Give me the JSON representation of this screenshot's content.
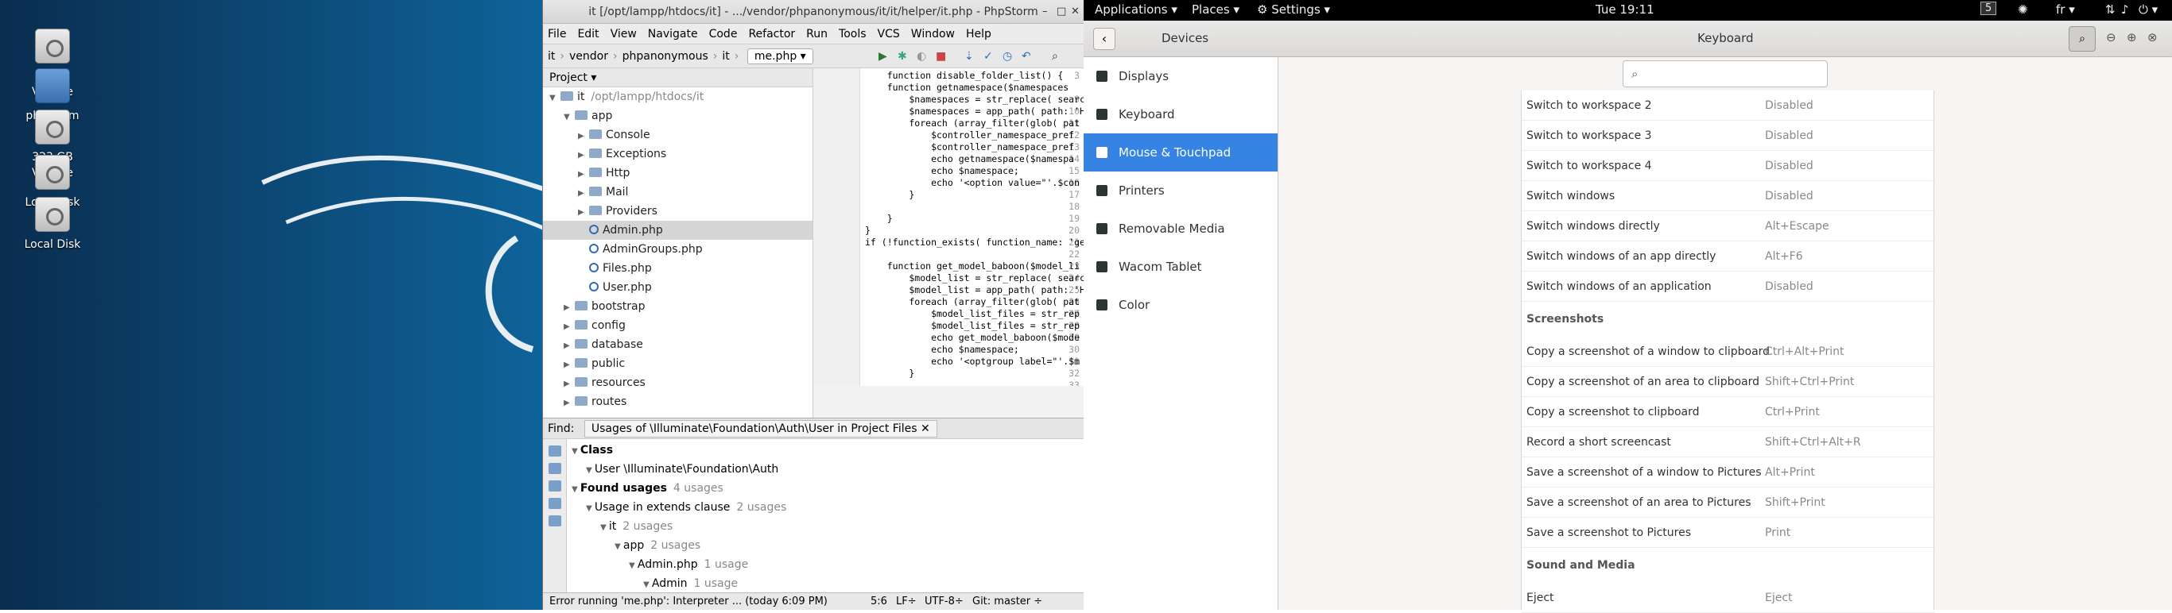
{
  "desktop": {
    "icons": [
      {
        "label": "2GB Volume",
        "type": "drive"
      },
      {
        "label": "phpstorm",
        "type": "folder"
      },
      {
        "label": "323 GB Volume",
        "type": "drive"
      },
      {
        "label": "Local disk",
        "type": "drive"
      },
      {
        "label": "Local Disk",
        "type": "drive"
      }
    ]
  },
  "topbar": {
    "applications": "Applications ▾",
    "places": "Places ▾",
    "settings": "Settings ▾",
    "clock": "Tue 19:11",
    "workspace": "5",
    "lang": "fr ▾"
  },
  "phpstorm": {
    "title": "it [/opt/lampp/htdocs/it] - .../vendor/phpanonymous/it/it/helper/it.php - PhpStorm",
    "menu": [
      "File",
      "Edit",
      "View",
      "Navigate",
      "Code",
      "Refactor",
      "Run",
      "Tools",
      "VCS",
      "Window",
      "Help"
    ],
    "breadcrumbs": [
      "it",
      "vendor",
      "phpanonymous",
      "it"
    ],
    "file_tab": "me.php ▾",
    "project_header": "Project ▾",
    "tree": [
      {
        "label": "it",
        "extra": "/opt/lampp/htdocs/it",
        "kind": "folder",
        "depth": 0,
        "open": true
      },
      {
        "label": "app",
        "kind": "folder",
        "depth": 1,
        "open": true
      },
      {
        "label": "Console",
        "kind": "folder",
        "depth": 2
      },
      {
        "label": "Exceptions",
        "kind": "folder",
        "depth": 2
      },
      {
        "label": "Http",
        "kind": "folder",
        "depth": 2
      },
      {
        "label": "Mail",
        "kind": "folder",
        "depth": 2
      },
      {
        "label": "Providers",
        "kind": "folder",
        "depth": 2
      },
      {
        "label": "Admin.php",
        "kind": "php",
        "depth": 2,
        "selected": true
      },
      {
        "label": "AdminGroups.php",
        "kind": "php",
        "depth": 2
      },
      {
        "label": "Files.php",
        "kind": "php",
        "depth": 2
      },
      {
        "label": "User.php",
        "kind": "php",
        "depth": 2
      },
      {
        "label": "bootstrap",
        "kind": "folder",
        "depth": 1
      },
      {
        "label": "config",
        "kind": "folder",
        "depth": 1
      },
      {
        "label": "database",
        "kind": "folder",
        "depth": 1
      },
      {
        "label": "public",
        "kind": "folder",
        "depth": 1
      },
      {
        "label": "resources",
        "kind": "folder",
        "depth": 1
      },
      {
        "label": "routes",
        "kind": "folder",
        "depth": 1
      }
    ],
    "code_lines": [
      {
        "n": "3",
        "t": "    function disable_folder_list() {"
      },
      {
        "n": "",
        "t": "    function getnamespace($namespaces"
      },
      {
        "n": "9",
        "t": "        $namespaces = str_replace( search"
      },
      {
        "n": "10",
        "t": "        $namespaces = app_path( path: 'Ht"
      },
      {
        "n": "11",
        "t": "        foreach (array_filter(glob( pat"
      },
      {
        "n": "12",
        "t": "            $controller_namespace_pref"
      },
      {
        "n": "13",
        "t": "            $controller_namespace_pref"
      },
      {
        "n": "14",
        "t": "            echo getnamespace($namespa"
      },
      {
        "n": "15",
        "t": "            echo $namespace;"
      },
      {
        "n": "16",
        "t": "            echo '<option value=\"'.$con"
      },
      {
        "n": "17",
        "t": "        }"
      },
      {
        "n": "18",
        "t": ""
      },
      {
        "n": "19",
        "t": "    }"
      },
      {
        "n": "20",
        "t": "}"
      },
      {
        "n": "21",
        "t": "if (!function_exists( function_name: 'get_m"
      },
      {
        "n": "22",
        "t": ""
      },
      {
        "n": "23",
        "t": "    function get_model_baboon($model_li"
      },
      {
        "n": "24",
        "t": "        $model_list = str_replace( search"
      },
      {
        "n": "25",
        "t": "        $model_list = app_path( path: 'Ht"
      },
      {
        "n": "26",
        "t": "        foreach (array_filter(glob( pat"
      },
      {
        "n": "27",
        "t": "            $model_list_files = str_rep"
      },
      {
        "n": "28",
        "t": "            $model_list_files = str_rep"
      },
      {
        "n": "29",
        "t": "            echo get_model_baboon($mode"
      },
      {
        "n": "30",
        "t": "            echo $namespace;"
      },
      {
        "n": "31",
        "t": "            echo '<optgroup label=\"'.$m"
      },
      {
        "n": "32",
        "t": "        }"
      },
      {
        "n": "33",
        "t": ""
      }
    ],
    "find": {
      "label": "Find:",
      "tab": "Usages of \\Illuminate\\Foundation\\Auth\\User in Project Files",
      "rows": [
        {
          "text": "Class",
          "bold": true,
          "depth": 0,
          "suffix": ""
        },
        {
          "text": "User  \\Illuminate\\Foundation\\Auth",
          "bold": false,
          "depth": 1,
          "suffix": ""
        },
        {
          "text": "Found usages",
          "bold": true,
          "depth": 0,
          "suffix": "4 usages"
        },
        {
          "text": "Usage in extends clause",
          "bold": false,
          "depth": 1,
          "suffix": "2 usages"
        },
        {
          "text": "it",
          "bold": false,
          "depth": 2,
          "suffix": "2 usages"
        },
        {
          "text": "app",
          "bold": false,
          "depth": 3,
          "suffix": "2 usages"
        },
        {
          "text": "Admin.php",
          "bold": false,
          "depth": 4,
          "suffix": "1 usage"
        },
        {
          "text": "Admin",
          "bold": false,
          "depth": 5,
          "suffix": "1 usage"
        }
      ]
    },
    "status": {
      "message": "Error running 'me.php': Interpreter ... (today 6:09 PM)",
      "pos": "5:6",
      "lf": "LF÷",
      "enc": "UTF-8÷",
      "git": "Git: master ÷"
    }
  },
  "settings": {
    "panel_title": "Devices",
    "page_title": "Keyboard",
    "search_placeholder": "",
    "sidebar": [
      {
        "label": "Displays",
        "active": false
      },
      {
        "label": "Keyboard",
        "active": false
      },
      {
        "label": "Mouse & Touchpad",
        "active": true
      },
      {
        "label": "Printers",
        "active": false
      },
      {
        "label": "Removable Media",
        "active": false
      },
      {
        "label": "Wacom Tablet",
        "active": false
      },
      {
        "label": "Color",
        "active": false
      }
    ],
    "shortcuts": [
      {
        "name": "Switch to workspace 2",
        "value": "Disabled"
      },
      {
        "name": "Switch to workspace 3",
        "value": "Disabled"
      },
      {
        "name": "Switch to workspace 4",
        "value": "Disabled"
      },
      {
        "name": "Switch windows",
        "value": "Disabled"
      },
      {
        "name": "Switch windows directly",
        "value": "Alt+Escape"
      },
      {
        "name": "Switch windows of an app directly",
        "value": "Alt+F6"
      },
      {
        "name": "Switch windows of an application",
        "value": "Disabled"
      }
    ],
    "screenshots_header": "Screenshots",
    "screenshots": [
      {
        "name": "Copy a screenshot of a window to clipboard",
        "value": "Ctrl+Alt+Print"
      },
      {
        "name": "Copy a screenshot of an area to clipboard",
        "value": "Shift+Ctrl+Print"
      },
      {
        "name": "Copy a screenshot to clipboard",
        "value": "Ctrl+Print"
      },
      {
        "name": "Record a short screencast",
        "value": "Shift+Ctrl+Alt+R"
      },
      {
        "name": "Save a screenshot of a window to Pictures",
        "value": "Alt+Print"
      },
      {
        "name": "Save a screenshot of an area to Pictures",
        "value": "Shift+Print"
      },
      {
        "name": "Save a screenshot to Pictures",
        "value": "Print"
      }
    ],
    "media_header": "Sound and Media",
    "media": [
      {
        "name": "Eject",
        "value": "Eject"
      }
    ]
  }
}
